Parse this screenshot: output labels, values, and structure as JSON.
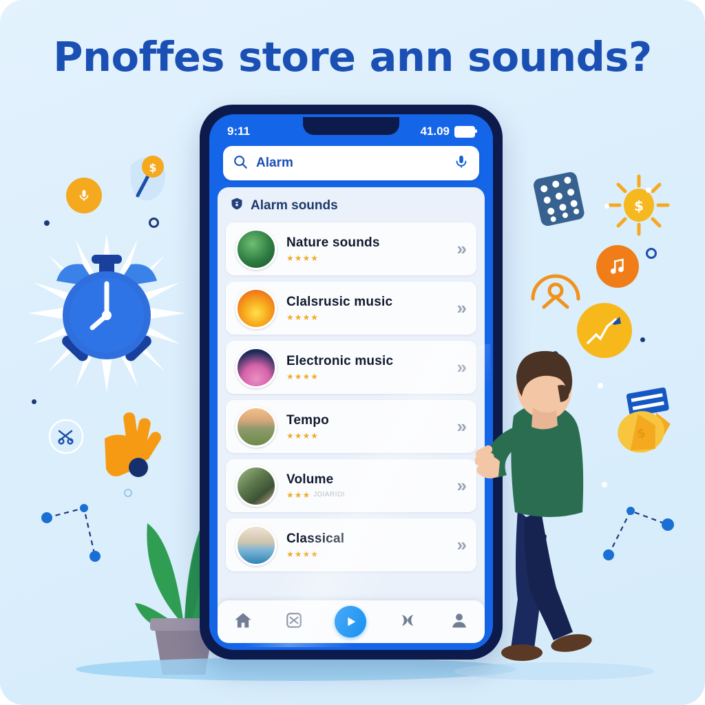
{
  "title": "Pnoffes store ann sounds?",
  "colors": {
    "background": "#dceefb",
    "title": "#1a4fb4",
    "phone_frame": "#0d1b4c",
    "status_blue": "#1565e8",
    "accent_orange": "#f5a01e",
    "star_gold": "#eeac2c",
    "play_blue": "#2196f3",
    "panel": "#eaf1fa"
  },
  "phone": {
    "status_bar": {
      "time": "9:11",
      "right_text": "41.09",
      "battery_icon": "battery-icon"
    },
    "search": {
      "icon": "search-icon",
      "value": "Alarm",
      "placeholder": "Alarm",
      "mic_icon": "microphone-icon"
    },
    "section": {
      "icon": "shield-badge-icon",
      "title": "Alarm sounds"
    },
    "list": [
      {
        "title": "Nature sounds",
        "stars": 4,
        "thumb": "tropical-leaves",
        "chevron": "»",
        "subtext": ""
      },
      {
        "title": "Clalsrusic music",
        "stars": 4,
        "thumb": "orange-flower",
        "chevron": "»",
        "subtext": ""
      },
      {
        "title": "Electronic music",
        "stars": 4,
        "thumb": "pink-lotus",
        "chevron": "»",
        "subtext": ""
      },
      {
        "title": "Tempo",
        "stars": 4,
        "thumb": "mountain-sunset",
        "chevron": "»",
        "subtext": ""
      },
      {
        "title": "Volume",
        "stars": 3,
        "thumb": "people-photo",
        "chevron": "»",
        "subtext": "JDIARIDI"
      },
      {
        "title": "Classical",
        "stars": 4,
        "thumb": "city-waterfront",
        "chevron": "»",
        "subtext": ""
      }
    ],
    "nav": [
      {
        "icon": "home-icon",
        "label": "Home"
      },
      {
        "icon": "grid-shuffle-icon",
        "label": "Browse"
      },
      {
        "icon": "play-icon",
        "label": "Play"
      },
      {
        "icon": "waveform-icon",
        "label": "Sounds"
      },
      {
        "icon": "person-icon",
        "label": "Profile"
      }
    ]
  },
  "decorations": {
    "left": [
      {
        "name": "microphone-badge-icon"
      },
      {
        "name": "dollar-magnifier-icon"
      },
      {
        "name": "alarm-clock-illustration"
      },
      {
        "name": "orange-hand-icon"
      },
      {
        "name": "circled-scissors-icon"
      },
      {
        "name": "dashed-network-left"
      },
      {
        "name": "potted-plant-illustration"
      }
    ],
    "right": [
      {
        "name": "dotted-grid-icon"
      },
      {
        "name": "sun-dollar-icon"
      },
      {
        "name": "music-note-badge-icon"
      },
      {
        "name": "arc-person-icon"
      },
      {
        "name": "rocket-chart-badge-icon"
      },
      {
        "name": "piggy-bank-icon"
      },
      {
        "name": "blue-card-icon"
      },
      {
        "name": "dashed-network-right"
      }
    ],
    "character": {
      "name": "person-using-phone-illustration"
    }
  }
}
